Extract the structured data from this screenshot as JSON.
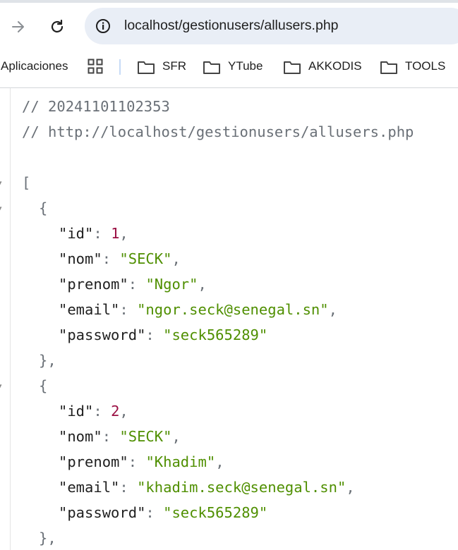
{
  "browser": {
    "url": "localhost/gestionusers/allusers.php"
  },
  "bookmarks": {
    "apps_label": "Aplicaciones",
    "folders": [
      "SFR",
      "YTube",
      "AKKODIS",
      "TOOLS"
    ]
  },
  "json_view": {
    "comment_timestamp": "// 20241101102353",
    "comment_url": "// http://localhost/gestionusers/allusers.php",
    "open_bracket": "[",
    "users": [
      {
        "id": "1",
        "nom": "\"SECK\"",
        "prenom": "\"Ngor\"",
        "email": "\"ngor.seck@senegal.sn\"",
        "password": "\"seck565289\""
      },
      {
        "id": "2",
        "nom": "\"SECK\"",
        "prenom": "\"Khadim\"",
        "email": "\"khadim.seck@senegal.sn\"",
        "password": "\"seck565289\""
      }
    ],
    "keys": {
      "id": "\"id\"",
      "nom": "\"nom\"",
      "prenom": "\"prenom\"",
      "email": "\"email\"",
      "password": "\"password\""
    },
    "open_brace": "{",
    "close_brace": "},"
  },
  "colors": {
    "comment": "#6a7077",
    "number": "#9b1044",
    "string": "#4f8f00",
    "omnibox": "#e9eef6"
  },
  "icons": [
    "forward-arrow-icon",
    "reload-icon",
    "site-info-icon",
    "apps-grid-icon",
    "folder-icon",
    "fold-arrow-icon"
  ]
}
